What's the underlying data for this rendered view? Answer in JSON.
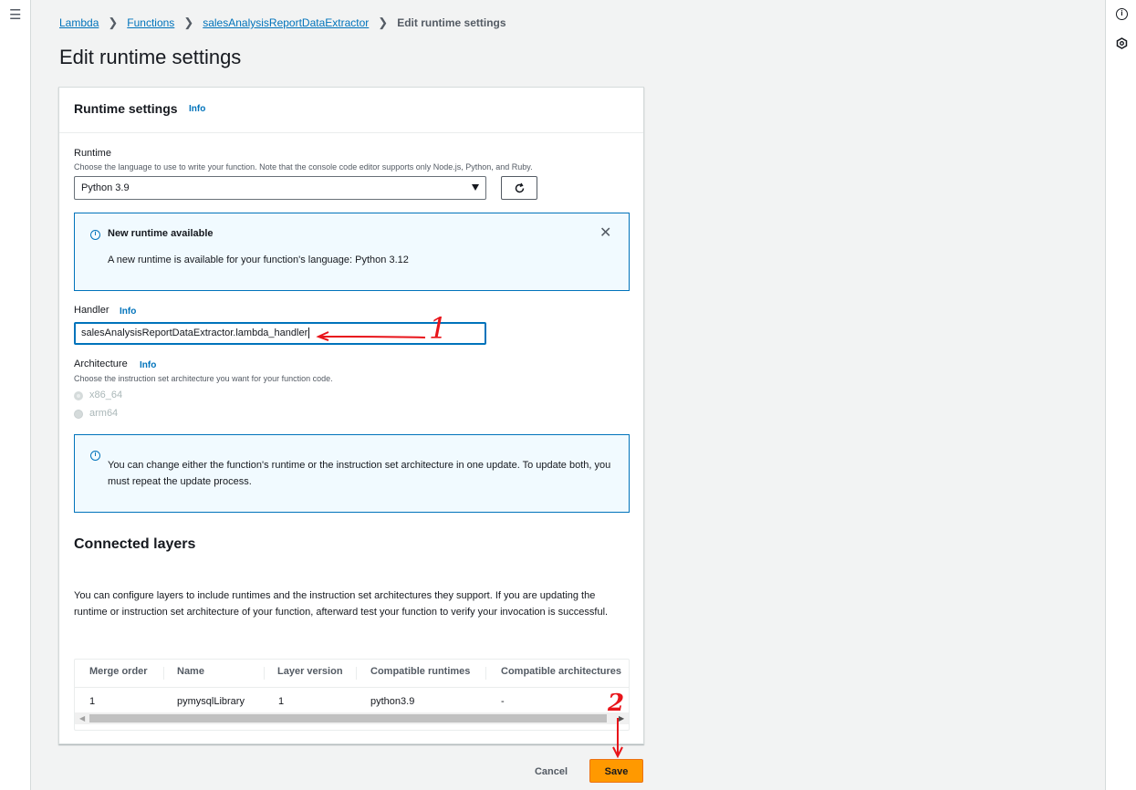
{
  "breadcrumb": {
    "items": [
      "Lambda",
      "Functions",
      "salesAnalysisReportDataExtractor"
    ],
    "current": "Edit runtime settings"
  },
  "page_title": "Edit runtime settings",
  "rails": {
    "right_icons": [
      "info-icon",
      "settings-icon"
    ]
  },
  "runtime_settings": {
    "heading": "Runtime settings",
    "info": "Info",
    "runtime": {
      "label": "Runtime",
      "description": "Choose the language to use to write your function. Note that the console code editor supports only Node.js, Python, and Ruby.",
      "value": "Python 3.9"
    },
    "alert": {
      "title": "New runtime available",
      "body": "A new runtime is available for your function's language: Python 3.12"
    },
    "handler": {
      "label": "Handler",
      "info": "Info",
      "value": "salesAnalysisReportDataExtractor.lambda_handler"
    },
    "architecture": {
      "label": "Architecture",
      "info": "Info",
      "description": "Choose the instruction set architecture you want for your function code.",
      "options": [
        {
          "label": "x86_64",
          "selected": true,
          "disabled": true
        },
        {
          "label": "arm64",
          "selected": false,
          "disabled": true
        }
      ]
    },
    "arch_alert": "You can change either the function's runtime or the instruction set architecture in one update. To update both, you must repeat the update process."
  },
  "connected_layers": {
    "heading": "Connected layers",
    "description": "You can configure layers to include runtimes and the instruction set architectures they support. If you are updating the runtime or instruction set architecture of your function, afterward test your function to verify your invocation is successful.",
    "columns": [
      "Merge order",
      "Name",
      "Layer version",
      "Compatible runtimes",
      "Compatible architectures"
    ],
    "rows": [
      [
        "1",
        "pymysqlLibrary",
        "1",
        "python3.9",
        "-"
      ]
    ]
  },
  "actions": {
    "cancel": "Cancel",
    "save": "Save"
  },
  "annotations": {
    "mark1": "1",
    "mark2": "2",
    "color": "#e8141a"
  }
}
